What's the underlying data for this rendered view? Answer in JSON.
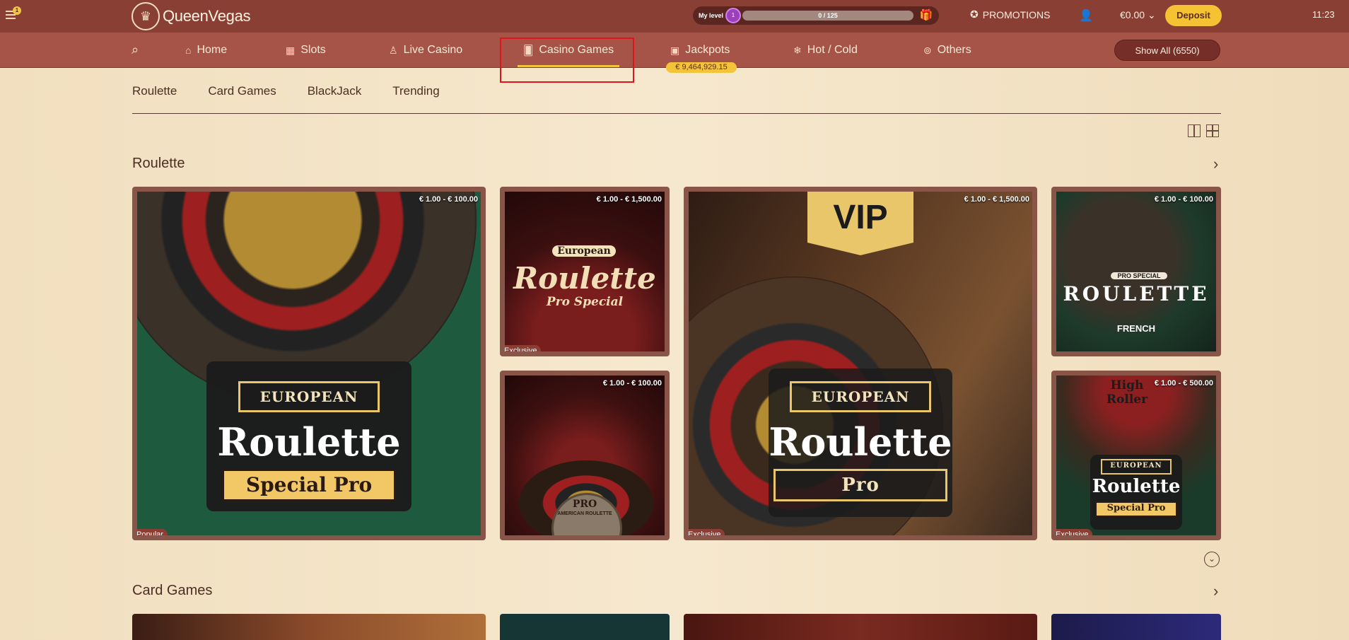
{
  "topbar": {
    "notification_count": "1",
    "logo_text": "QueenVegas",
    "level_label": "My level",
    "level_value": "1",
    "level_progress_text": "0 / 125",
    "level_progress_fraction": 0.0,
    "promotions_label": "PROMOTIONS",
    "balance": "€0.00",
    "deposit_label": "Deposit",
    "clock": "11:23"
  },
  "nav": {
    "items": [
      {
        "label": "Home",
        "icon": "home-icon"
      },
      {
        "label": "Slots",
        "icon": "slot-machine-icon"
      },
      {
        "label": "Live Casino",
        "icon": "dealer-icon"
      },
      {
        "label": "Casino Games",
        "icon": "cards-icon",
        "active": true
      },
      {
        "label": "Jackpots",
        "icon": "jackpot-icon"
      },
      {
        "label": "Hot / Cold",
        "icon": "snowflake-icon"
      },
      {
        "label": "Others",
        "icon": "chips-icon"
      }
    ],
    "jackpot_amount": "€ 9,464,929.15",
    "show_all_label": "Show All (6550)"
  },
  "subtabs": [
    "Roulette",
    "Card Games",
    "BlackJack",
    "Trending"
  ],
  "sections": {
    "roulette": {
      "title": "Roulette",
      "games": [
        {
          "price": "€ 1.00 - € 100.00",
          "badge": "Popular",
          "line1": "EUROPEAN",
          "line2": "Roulette",
          "line3": "Special Pro"
        },
        {
          "price": "€ 1.00 - € 1,500.00",
          "badge": "Exclusive",
          "line1": "European",
          "line2": "Roulette",
          "line3": "Pro Special"
        },
        {
          "price": "€ 1.00 - € 100.00",
          "badge": "",
          "line1": "PRO",
          "line2": "AMERICAN ROULETTE",
          "line3": ""
        },
        {
          "price": "€ 1.00 - € 1,500.00",
          "badge": "Exclusive",
          "line0": "VIP",
          "line1": "EUROPEAN",
          "line2": "Roulette",
          "line3": "Pro"
        },
        {
          "price": "€ 1.00 - € 100.00",
          "badge": "",
          "line1": "PRO SPECIAL",
          "line2": "ROULETTE",
          "line3": "FRENCH"
        },
        {
          "price": "€ 1.00 - € 500.00",
          "badge": "Exclusive",
          "line0": "High Roller",
          "line1": "EUROPEAN",
          "line2": "Roulette",
          "line3": "Special Pro"
        }
      ]
    },
    "card_games": {
      "title": "Card Games"
    }
  }
}
